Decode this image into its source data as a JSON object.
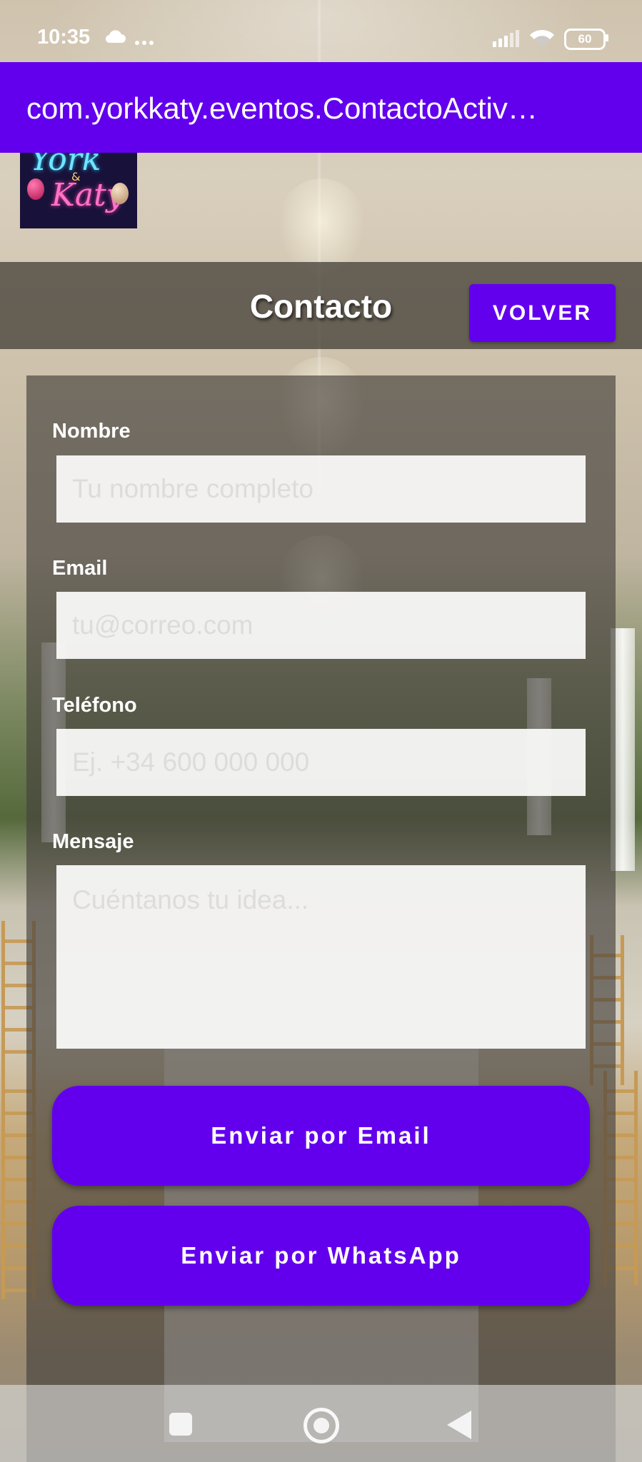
{
  "status_bar": {
    "time": "10:35",
    "cloud_icon": "cloud-icon",
    "more_icon": "more-dots-icon",
    "signal_icon": "signal-icon",
    "wifi_icon": "wifi-icon",
    "battery_level": "60"
  },
  "app_bar": {
    "title": "com.yorkkaty.eventos.ContactoActiv…",
    "color": "#6200ee"
  },
  "logo": {
    "text_line1": "York",
    "text_amp": "&",
    "text_line2": "Katy"
  },
  "header": {
    "title": "Contacto",
    "back_label": "VOLVER"
  },
  "form": {
    "name_label": "Nombre",
    "name_placeholder": "Tu nombre completo",
    "email_label": "Email",
    "email_placeholder": "tu@correo.com",
    "phone_label": "Teléfono",
    "phone_placeholder": "Ej. +34 600 000 000",
    "message_label": "Mensaje",
    "message_placeholder": "Cuéntanos tu idea..."
  },
  "actions": {
    "email_button": "Enviar por Email",
    "whatsapp_button": "Enviar por WhatsApp"
  },
  "nav_bar": {
    "recent_icon": "square-recents-icon",
    "home_icon": "circle-home-icon",
    "back_icon": "triangle-back-icon"
  }
}
